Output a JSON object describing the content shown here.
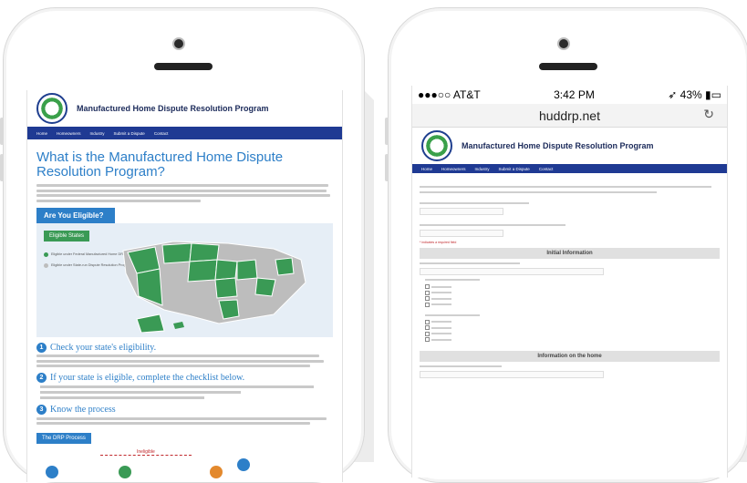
{
  "phone_left": {
    "site": {
      "title": "Manufactured Home Dispute Resolution Program",
      "nav": [
        "Home",
        "Homeowners",
        "Industry",
        "Submit a Dispute",
        "Contact"
      ]
    },
    "heading": "What is the Manufactured Home Dispute Resolution Program?",
    "eligible_banner": "Are You Eligible?",
    "map": {
      "eligible_states_label": "Eligible States",
      "legend": [
        "Eligible under Federal Manufactured Home DRP",
        "Eligible under State-run Dispute Resolution Program"
      ],
      "colors": {
        "federal": "#3a9a55",
        "state": "#bdbdbd"
      }
    },
    "steps": [
      {
        "num": "1",
        "title": "Check your state's eligibility."
      },
      {
        "num": "2",
        "title": "If your state is eligible, complete the checklist below."
      },
      {
        "num": "3",
        "title": "Know the process"
      }
    ],
    "drp_process_label": "The DRP Process",
    "drp_arrow_label": "Ineligible"
  },
  "phone_right": {
    "status": {
      "carrier": "●●●○○ AT&T",
      "time": "3:42 PM",
      "battery": "43%"
    },
    "url": "huddrp.net",
    "site": {
      "title": "Manufactured Home Dispute Resolution Program",
      "nav": [
        "Home",
        "Homeowners",
        "Industry",
        "Submit a Dispute",
        "Contact"
      ]
    },
    "required_note": "* indicates a required field",
    "section1": "Initial Information",
    "section2": "Information on the home"
  },
  "colors": {
    "brand_blue": "#2d7fc8",
    "nav_blue": "#1f3a93",
    "green": "#3a9a55"
  }
}
